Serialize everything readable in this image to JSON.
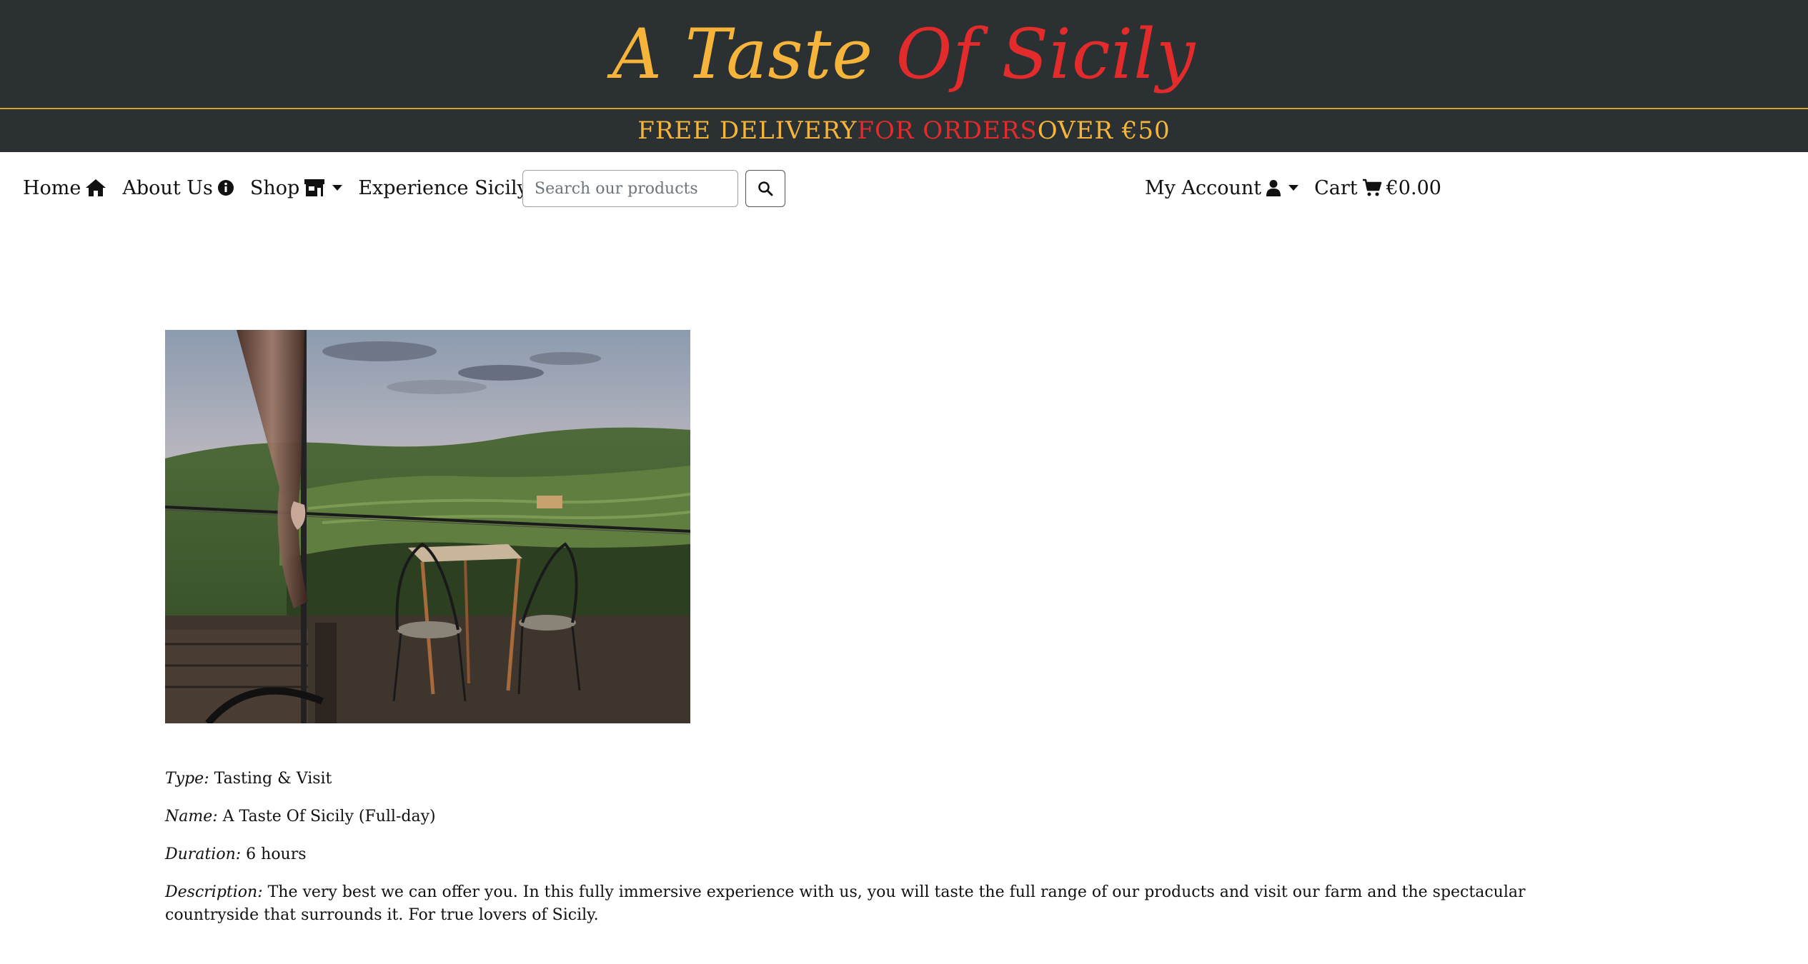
{
  "header": {
    "brand_part1": "A Taste ",
    "brand_part2": "Of Sicily",
    "brand_colors": {
      "part1": "#f6b53a",
      "part2": "#e32b2b",
      "background": "#2b3132"
    }
  },
  "banner": {
    "part1": "FREE DELIVERY ",
    "part2": "FOR ORDERS",
    "part3": " OVER €50"
  },
  "nav": {
    "home": "Home",
    "about": "About Us",
    "shop": "Shop",
    "experience": "Experience Sicily",
    "search_placeholder": "Search our products",
    "account": "My Account",
    "cart_label": "Cart",
    "cart_total": "€0.00",
    "icons": [
      "home-icon",
      "info-icon",
      "store-icon",
      "luggage-icon",
      "search-icon",
      "user-icon",
      "cart-icon"
    ]
  },
  "experience": {
    "image_alt": "Terrace with table and chairs overlooking vineyard hills at sunset",
    "type_label": "Type:",
    "type_value": "Tasting & Visit",
    "name_label": "Name:",
    "name_value": "A Taste Of Sicily (Full-day)",
    "duration_label": "Duration:",
    "duration_value": "6 hours",
    "description_label": "Description:",
    "description_value": "The very best we can offer you. In this fully immersive experience with us, you will taste the full range of our products and visit our farm and the spectacular countryside that surrounds it. For true lovers of Sicily."
  }
}
